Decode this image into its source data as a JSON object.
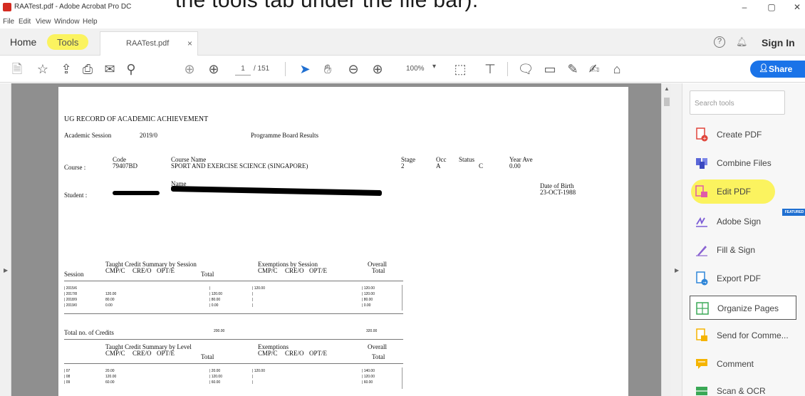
{
  "caption": {
    "text": "the tools tab under the file bar)."
  },
  "window": {
    "title": "RAATest.pdf - Adobe Acrobat Pro DC",
    "minimize": "–",
    "maximize": "▢",
    "close": "✕"
  },
  "menu": [
    "File",
    "Edit",
    "View",
    "Window",
    "Help"
  ],
  "tabs": {
    "home": "Home",
    "tools": "Tools",
    "file": "RAATest.pdf",
    "file_close": "×",
    "sign_in": "Sign In"
  },
  "toolbar": {
    "page_current": "1",
    "page_total": "/ 151",
    "zoom": "100%",
    "zoom_arrow": "▾",
    "share": "Share"
  },
  "document": {
    "heading": "UG RECORD OF ACADEMIC ACHIEVEMENT",
    "session_label": "Academic Session",
    "session_value": "2019/0",
    "board": "Programme Board Results",
    "code_label": "Code",
    "code_value": "79407BD",
    "course_name_label": "Course Name",
    "course_name": "SPORT AND EXERCISE SCIENCE (SINGAPORE)",
    "course_label": "Course :",
    "stage_label": "Stage",
    "stage_value": "2",
    "occ_label": "Occ",
    "occ_value": "A",
    "status_label": "Status",
    "status_value": "C",
    "year_ave_label": "Year Ave",
    "year_ave_value": "0.00",
    "name_label": "Name",
    "student_label": "Student :",
    "dob_label": "Date of Birth",
    "dob_value": "23-OCT-1988",
    "session_table": {
      "group1": "Taught Credit Summary by Session",
      "group2": "Exemptions by Session",
      "overall": "Overall",
      "session_col": "Session",
      "cols": [
        "CMP/C",
        "CRE/O",
        "OPT/E",
        "Total"
      ],
      "ex_cols": [
        "CMP/C",
        "CRE/O",
        "OPT/E"
      ],
      "total_col": "Total",
      "rows": [
        {
          "session": "| 2015/6",
          "cmp": "",
          "total": "|",
          "ex": "| 120.00",
          "overall": "| 120.00"
        },
        {
          "session": "| 2017/8",
          "cmp": "120.00",
          "total": "| 120.00",
          "ex": "|",
          "overall": "| 120.00"
        },
        {
          "session": "| 2018/9",
          "cmp": "80.00",
          "total": "| 80.00",
          "ex": "|",
          "overall": "| 80.00"
        },
        {
          "session": "| 2019/0",
          "cmp": "0.00",
          "total": "| 0.00",
          "ex": "|",
          "overall": "| 0.00"
        }
      ],
      "total_label": "Total no. of Credits",
      "total_value": "200.00",
      "overall_total": "320.00"
    },
    "level_table": {
      "group1": "Taught Credit Summary by Level",
      "group2": "Exemptions",
      "overall": "Overall",
      "cols": [
        "CMP/C",
        "CRE/O",
        "OPT/E",
        "Total"
      ],
      "ex_cols": [
        "CMP/C",
        "CRE/O",
        "OPT/E"
      ],
      "total_col": "Total",
      "rows": [
        {
          "level": "| 07",
          "cmp": "20.00",
          "total": "| 20.00",
          "ex": "| 120.00",
          "overall": "| 140.00"
        },
        {
          "level": "| 08",
          "cmp": "120.00",
          "total": "| 120.00",
          "ex": "|",
          "overall": "| 120.00"
        },
        {
          "level": "| 09",
          "cmp": "60.00",
          "total": "| 60.00",
          "ex": "|",
          "overall": "| 60.00"
        }
      ]
    }
  },
  "tools_pane": {
    "search_placeholder": "Search tools",
    "featured_badge": "FEATURED",
    "items": [
      {
        "label": "Create PDF",
        "color": "#e0443a"
      },
      {
        "label": "Combine Files",
        "color": "#5a67d8"
      },
      {
        "label": "Edit PDF",
        "color": "#e05aa8"
      },
      {
        "label": "Adobe Sign",
        "color": "#7b5cd6"
      },
      {
        "label": "Fill & Sign",
        "color": "#8a63d2"
      },
      {
        "label": "Export PDF",
        "color": "#2f86d8"
      },
      {
        "label": "Organize Pages",
        "color": "#3aa856"
      },
      {
        "label": "Send for Comme...",
        "color": "#f5b400"
      },
      {
        "label": "Comment",
        "color": "#f5b400"
      },
      {
        "label": "Scan & OCR",
        "color": "#3aa856"
      }
    ]
  },
  "colors": {
    "highlight": "#fbf35f",
    "share_blue": "#1a73e8",
    "doc_background": "#8f8f8f"
  }
}
